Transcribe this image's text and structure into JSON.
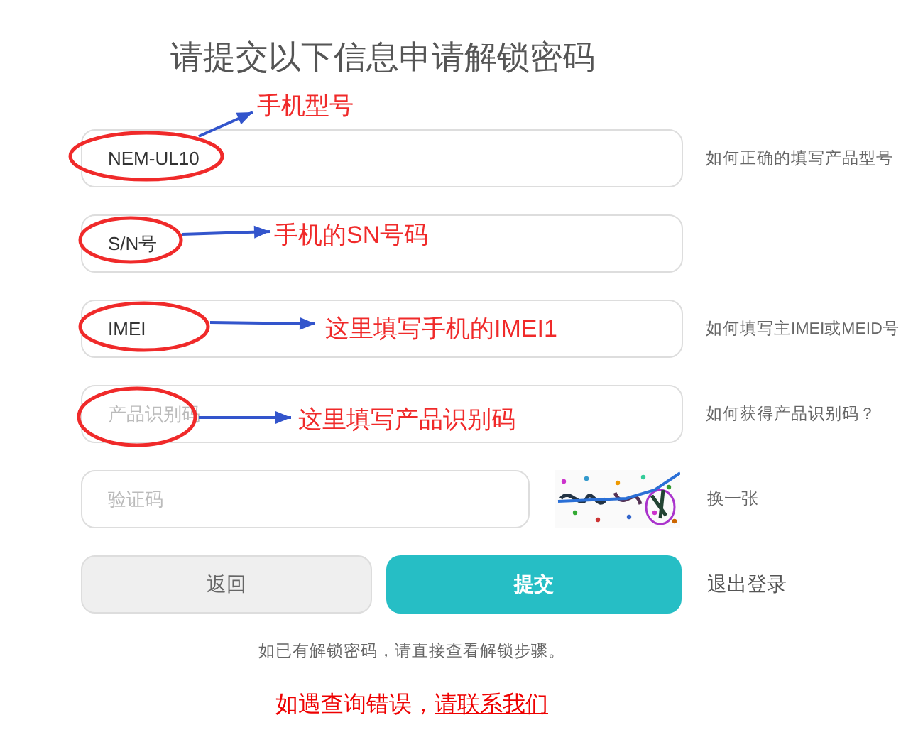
{
  "title": "请提交以下信息申请解锁密码",
  "fields": [
    {
      "value": "NEM-UL10",
      "help": "如何正确的填写产品型号",
      "annotation": "手机型号"
    },
    {
      "value": "S/N号",
      "annotation": "手机的SN号码"
    },
    {
      "value": "IMEI",
      "help": "如何填写主IMEI或MEID号",
      "annotation": "这里填写手机的IMEI1"
    },
    {
      "placeholder": "产品识别码",
      "help": "如何获得产品识别码？",
      "annotation": "这里填写产品识别码"
    }
  ],
  "captcha": {
    "placeholder": "验证码",
    "refresh": "换一张"
  },
  "buttons": {
    "back": "返回",
    "submit": "提交",
    "logout": "退出登录"
  },
  "note": "如已有解锁密码，请直接查看解锁步骤。",
  "error_line": {
    "text": "如遇查询错误，",
    "link": "请联系我们"
  }
}
